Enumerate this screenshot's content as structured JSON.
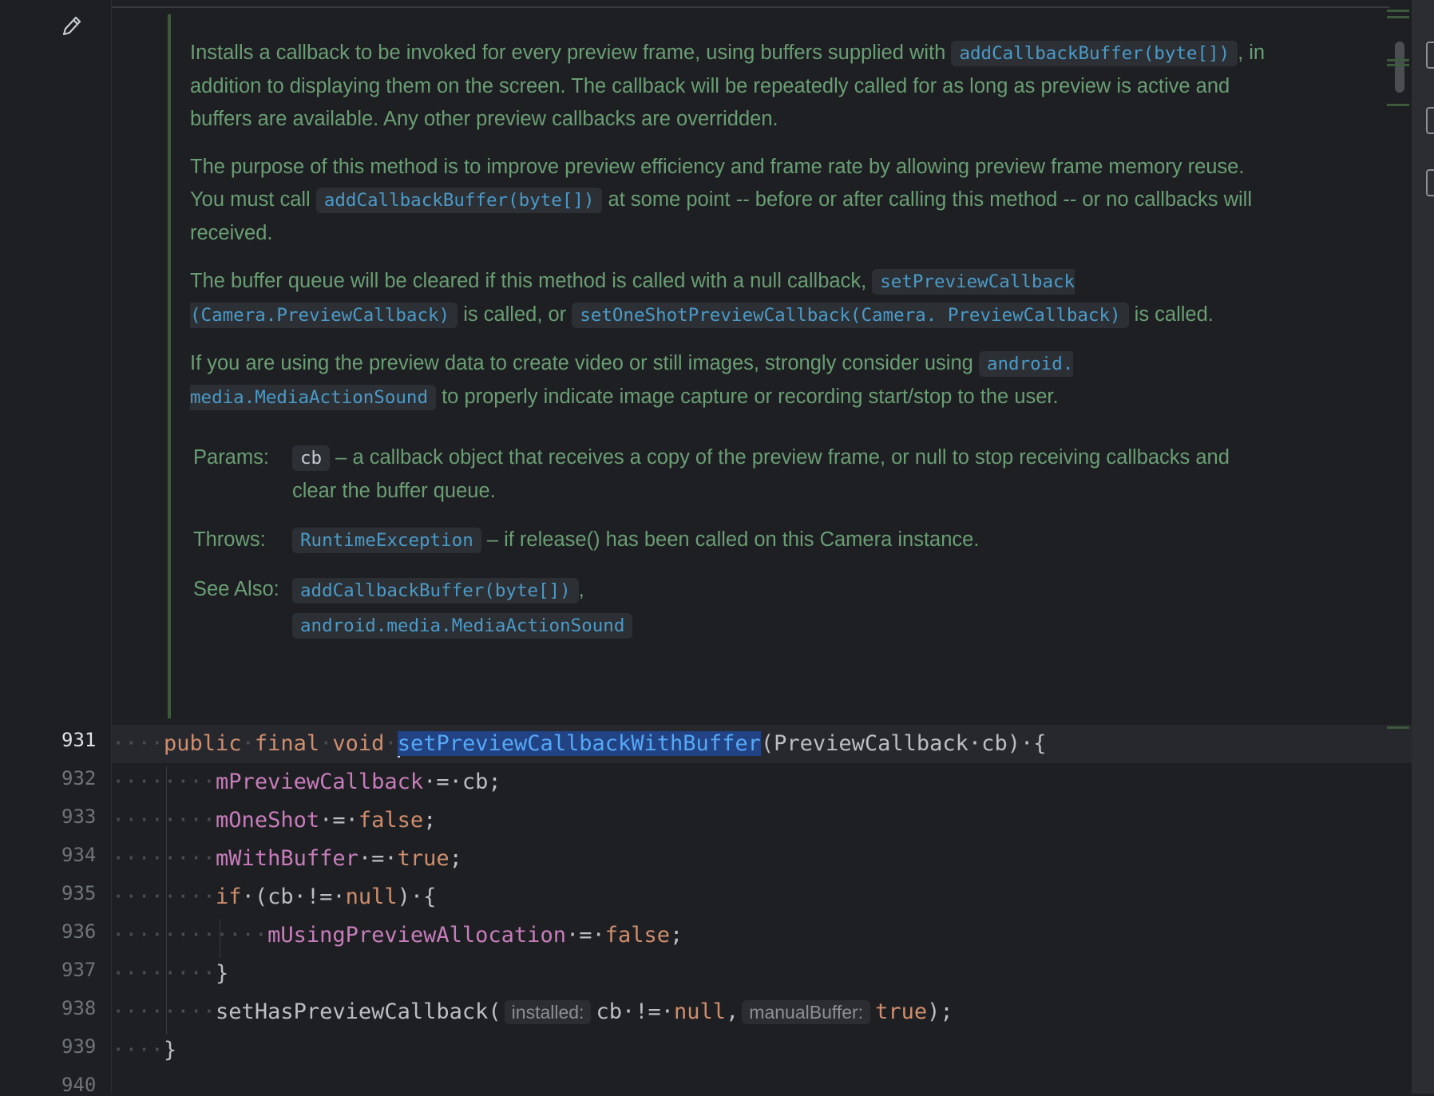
{
  "gutter": {
    "edit_icon": "pencil-icon",
    "line_numbers": [
      "931",
      "932",
      "933",
      "934",
      "935",
      "936",
      "937",
      "938",
      "939",
      "940"
    ]
  },
  "doc": {
    "p1": {
      "t1": "Installs a callback to be invoked for every preview frame, using buffers supplied with ",
      "c1": "addCallbackBuffer(byte[])",
      "t2": ", in addition to displaying them on the screen. The callback will be repeatedly called for as long as preview is active and buffers are available. Any other preview callbacks are overridden."
    },
    "p2": {
      "t1": "The purpose of this method is to improve preview efficiency and frame rate by allowing preview frame memory reuse. You must call ",
      "c1": "addCallbackBuffer(byte[])",
      "t2": " at some point -- before or after calling this method -- or no callbacks will received."
    },
    "p3": {
      "t1": "The buffer queue will be cleared if this method is called with a null callback, ",
      "c1": "setPreviewCallback (Camera.PreviewCallback)",
      "t2": " is called, or ",
      "c2": "setOneShotPreviewCallback(Camera. PreviewCallback)",
      "t3": " is called."
    },
    "p4": {
      "t1": "If you are using the preview data to create video or still images, strongly consider using ",
      "c1": "android. media.MediaActionSound",
      "t2": " to properly indicate image capture or recording start/stop to the user."
    },
    "params": {
      "label": "Params:",
      "code": "cb",
      "text": " – a callback object that receives a copy of the preview frame, or null to stop receiving callbacks and clear the buffer queue."
    },
    "throws": {
      "label": "Throws:",
      "code": "RuntimeException",
      "text": " – if release() has been called on this Camera instance."
    },
    "see_also": {
      "label": "See Also:",
      "link1": "addCallbackBuffer(byte[])",
      "sep": ",",
      "link2": "android.media.MediaActionSound"
    }
  },
  "code": {
    "l931": {
      "dots": "····",
      "kw1": "public",
      "s1": "·",
      "kw2": "final",
      "s2": "·",
      "kw3": "void",
      "s3": "·",
      "method": "setPreviewCallbackWithBuffer",
      "rest": "(PreviewCallback·cb)·{"
    },
    "l932": {
      "dots": "········",
      "field": "mPreviewCallback",
      "rest": "·=·cb;"
    },
    "l933": {
      "dots": "········",
      "field": "mOneShot",
      "op": "·=·",
      "kw": "false",
      "end": ";"
    },
    "l934": {
      "dots": "········",
      "field": "mWithBuffer",
      "op": "·=·",
      "kw": "true",
      "end": ";"
    },
    "l935": {
      "dots": "········",
      "kw": "if",
      "rest": "·(cb·!=·",
      "kw2": "null",
      "end": ")·{"
    },
    "l936": {
      "dots": "············",
      "field": "mUsingPreviewAllocation",
      "op": "·=·",
      "kw": "false",
      "end": ";"
    },
    "l937": {
      "dots": "········",
      "rest": "}"
    },
    "l938": {
      "dots": "········",
      "call": "setHasPreviewCallback(",
      "hint1": "installed:",
      "a1": "cb·!=·",
      "kw1": "null",
      "comma": ",",
      "hint2": "manualBuffer:",
      "kw2": "true",
      "end": ");"
    },
    "l939": {
      "dots": "····",
      "rest": "}"
    }
  },
  "colors": {
    "background": "#1e1f22",
    "doc_text": "#6a9e74",
    "code_link": "#4b9ac7",
    "keyword": "#cf8e6d",
    "field": "#c77dbb",
    "method": "#56a8f5"
  }
}
